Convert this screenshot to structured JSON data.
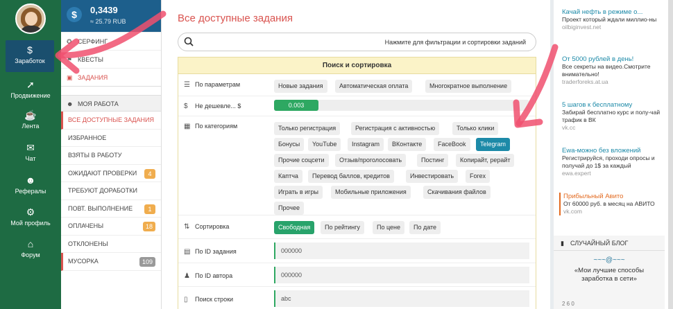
{
  "nav": {
    "items": [
      {
        "label": "Заработок",
        "icon": "moneybag-icon",
        "glyph": "$"
      },
      {
        "label": "Продвижение",
        "icon": "rocket-icon",
        "glyph": "➚"
      },
      {
        "label": "Лента",
        "icon": "coffee-icon",
        "glyph": "☕"
      },
      {
        "label": "Чат",
        "icon": "chat-icon",
        "glyph": "✉"
      },
      {
        "label": "Рефералы",
        "icon": "users-icon",
        "glyph": "☻"
      },
      {
        "label": "Мой профиль",
        "icon": "gear-icon",
        "glyph": "⚙"
      },
      {
        "label": "Форум",
        "icon": "bank-icon",
        "glyph": "⌂"
      }
    ]
  },
  "balance": {
    "amount": "0,3439",
    "rub": "≈ 25.79 RUB"
  },
  "menu_top": [
    {
      "label": "СЕРФИНГ",
      "icon": "compass-icon",
      "glyph": "✪"
    },
    {
      "label": "КВЕСТЫ",
      "icon": "flag-icon",
      "glyph": "⚑"
    },
    {
      "label": "ЗАДАНИЯ",
      "icon": "briefcase-icon",
      "glyph": "▣"
    }
  ],
  "my_work": {
    "title": "МОЯ РАБОТА",
    "items": [
      {
        "label": "ВСЕ ДОСТУПНЫЕ ЗАДАНИЯ",
        "badge": ""
      },
      {
        "label": "ИЗБРАННОЕ",
        "badge": ""
      },
      {
        "label": "ВЗЯТЫ В РАБОТУ",
        "badge": ""
      },
      {
        "label": "ОЖИДАЮТ ПРОВЕРКИ",
        "badge": "4"
      },
      {
        "label": "ТРЕБУЮТ ДОРАБОТКИ",
        "badge": ""
      },
      {
        "label": "ПОВТ. ВЫПОЛНЕНИЕ",
        "badge": "1"
      },
      {
        "label": "ОПЛАЧЕНЫ",
        "badge": "18"
      },
      {
        "label": "ОТКЛОНЕНЫ",
        "badge": ""
      },
      {
        "label": "МУСОРКА",
        "badge": "109"
      }
    ]
  },
  "main": {
    "title": "Все доступные задания",
    "filter_hint": "Нажмите для фильтрации и сортировки заданий",
    "panel_title": "Поиск и сортировка",
    "params_label": "По параметрам",
    "params": [
      "Новые задания",
      "Автоматическая оплата",
      "Многократное выполнение"
    ],
    "min_price_label": "Не дешевле... $",
    "min_price_value": "0.003",
    "categories_label": "По категориям",
    "categories": [
      "Только регистрация",
      "Регистрация с активностью",
      "Только клики",
      "Бонусы",
      "YouTube",
      "Instagram",
      "ВКонтакте",
      "FaceBook",
      "Telegram",
      "Прочие соцсети",
      "Отзыв/проголосовать",
      "Постинг",
      "Копирайт, рерайт",
      "Каптча",
      "Перевод баллов, кредитов",
      "Инвестировать",
      "Forex",
      "Играть в игры",
      "Мобильные приложения",
      "Скачивания файлов",
      "Прочее"
    ],
    "selected_category": "Telegram",
    "sort_label": "Сортировка",
    "sort_options": [
      "Свободная",
      "По рейтингу",
      "По цене",
      "По дате"
    ],
    "sort_selected": "Свободная",
    "task_id_label": "По ID задания",
    "task_id_placeholder": "000000",
    "author_id_label": "По ID автора",
    "author_id_placeholder": "000000",
    "search_label": "Поиск строки",
    "search_placeholder": "abc"
  },
  "ads": [
    {
      "title": "Качай нефть в режиме о...",
      "desc": "Проект который ждали миллио-ны",
      "site": "oilbiginvest.net"
    },
    {
      "title": "От 5000 рублей в день!",
      "desc": "Все секреты на видео.Смотрите внимательно!",
      "site": "traderforeks.at.ua"
    },
    {
      "title": "5 шагов к бесплатному",
      "desc": "Забирай бесплатно курс и полу-чай трафик в ВК",
      "site": "vk.cc"
    },
    {
      "title": "Ewa-можно без вложений",
      "desc": "Регистрируйся, проходи опросы и получай до 1$ за каждый",
      "site": "ewa.expert"
    },
    {
      "title": "Прибыльный Авито",
      "desc": "От 60000 руб. в месяц на АВИТО",
      "site": "vk.com"
    }
  ],
  "blog": {
    "title": "СЛУЧАЙНЫЙ БЛОГ",
    "ornament": "~~~@~~~",
    "post": "«Мои лучшие способы заработка в сети»",
    "meta": "2  6  0"
  },
  "colors": {
    "nav_bg": "#1e6b43",
    "accent_red": "#d9534f",
    "link_blue": "#1d8aa8",
    "green": "#2ea862"
  }
}
